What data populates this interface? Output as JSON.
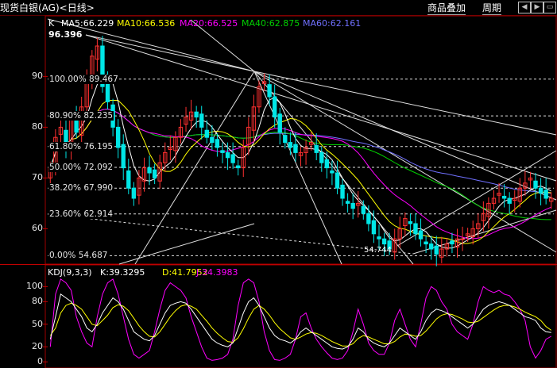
{
  "header": {
    "title": "现货白银(AG)<日线>",
    "btn_overlay": "商品叠加",
    "btn_period": "周期",
    "nav_icons": [
      "arrow-left-icon",
      "arrow-right-icon",
      "window-icon"
    ]
  },
  "main_panel": {
    "indicator": "K",
    "ma5_label": "MA5:66.229",
    "ma10_label": "MA10:66.536",
    "ma20_label": "MA20:66.525",
    "ma40_label": "MA40:62.875",
    "ma60_label": "MA60:62.161",
    "high_label": "96.396",
    "low_label": "54.744",
    "colors": {
      "ma5": "#ffffff",
      "ma10": "#ffff00",
      "ma20": "#ff00ff",
      "ma40": "#00d000",
      "ma60": "#7070ff",
      "up": "#ff3030",
      "down": "#00e6e6",
      "grid": "#7a0000",
      "axis": "#a00000"
    }
  },
  "fib_levels": [
    {
      "label": "100.00% 89.467",
      "value": 89.467
    },
    {
      "label": "80.90% 82.235",
      "value": 82.235
    },
    {
      "label": "61.80% 76.195",
      "value": 76.195
    },
    {
      "label": "50.00% 72.092",
      "value": 72.092
    },
    {
      "label": "38.20% 67.990",
      "value": 67.99
    },
    {
      "label": "23.60% 62.914",
      "value": 62.914
    },
    {
      "label": "0.00% 54.687",
      "value": 54.687
    }
  ],
  "kdj_panel": {
    "title": "KDJ(9,3,3)",
    "k_label": "K:39.3295",
    "d_label": "D:41.7952",
    "j_label": "J:34.3983",
    "colors": {
      "k": "#ffffff",
      "d": "#ffff00",
      "j": "#ff00ff"
    }
  },
  "chart_data": {
    "type": "candlestick",
    "price_yticks": [
      60,
      70,
      80,
      90
    ],
    "price_ylim": [
      53.5,
      98.5
    ],
    "kdj_yticks": [
      0,
      20,
      50,
      80,
      100
    ],
    "kdj_ylim": [
      -5,
      112
    ],
    "close": [
      72,
      78,
      80,
      76,
      82,
      79,
      84,
      89,
      94,
      96,
      88,
      85,
      80,
      76,
      72,
      68,
      66,
      70,
      72,
      71,
      70,
      73,
      75,
      76,
      78,
      80,
      82,
      83,
      82,
      80,
      78,
      77,
      76,
      75,
      74,
      73,
      72,
      76,
      80,
      84,
      88,
      89,
      86,
      82,
      79,
      77,
      76,
      75,
      75,
      76,
      77,
      75,
      73,
      72,
      71,
      68,
      66,
      65,
      64,
      65,
      63,
      61,
      59,
      58,
      57,
      56,
      58,
      60,
      62,
      61,
      59,
      58,
      57,
      56,
      55,
      56,
      57,
      57,
      58,
      58,
      59,
      60,
      61,
      63,
      65,
      66,
      67,
      66,
      65,
      66,
      68,
      69,
      70,
      68,
      67,
      66,
      66
    ],
    "k": [
      30,
      60,
      90,
      85,
      80,
      70,
      60,
      45,
      40,
      50,
      65,
      75,
      85,
      80,
      70,
      55,
      40,
      35,
      30,
      28,
      35,
      50,
      65,
      75,
      78,
      80,
      78,
      70,
      60,
      50,
      40,
      30,
      25,
      22,
      20,
      25,
      45,
      65,
      80,
      85,
      75,
      60,
      45,
      35,
      30,
      28,
      25,
      30,
      40,
      45,
      40,
      35,
      30,
      25,
      20,
      18,
      17,
      20,
      30,
      45,
      40,
      30,
      25,
      22,
      20,
      25,
      35,
      45,
      40,
      35,
      30,
      40,
      55,
      65,
      70,
      68,
      65,
      60,
      55,
      50,
      45,
      50,
      60,
      70,
      75,
      78,
      80,
      78,
      75,
      70,
      65,
      60,
      58,
      55,
      45,
      40,
      39
    ],
    "d": [
      35,
      45,
      65,
      75,
      78,
      75,
      70,
      60,
      50,
      48,
      55,
      62,
      72,
      76,
      74,
      68,
      58,
      48,
      40,
      34,
      33,
      40,
      50,
      60,
      68,
      74,
      76,
      74,
      70,
      62,
      54,
      45,
      38,
      32,
      27,
      26,
      32,
      44,
      58,
      70,
      75,
      70,
      62,
      52,
      44,
      38,
      32,
      30,
      33,
      37,
      39,
      38,
      35,
      31,
      27,
      24,
      21,
      21,
      24,
      31,
      35,
      33,
      30,
      27,
      24,
      24,
      27,
      33,
      37,
      36,
      34,
      35,
      41,
      49,
      57,
      62,
      64,
      63,
      60,
      57,
      53,
      52,
      54,
      59,
      64,
      69,
      73,
      75,
      75,
      73,
      70,
      66,
      63,
      60,
      55,
      47,
      42
    ],
    "j": [
      20,
      90,
      110,
      105,
      95,
      60,
      40,
      25,
      20,
      60,
      90,
      105,
      110,
      90,
      60,
      30,
      10,
      5,
      10,
      15,
      40,
      70,
      95,
      105,
      100,
      95,
      85,
      60,
      40,
      20,
      5,
      2,
      3,
      5,
      10,
      30,
      75,
      105,
      110,
      105,
      80,
      40,
      15,
      3,
      2,
      5,
      10,
      30,
      60,
      65,
      45,
      30,
      20,
      12,
      5,
      3,
      5,
      15,
      40,
      70,
      50,
      25,
      15,
      10,
      10,
      25,
      55,
      70,
      50,
      30,
      20,
      50,
      85,
      100,
      95,
      80,
      70,
      50,
      40,
      35,
      30,
      50,
      80,
      100,
      95,
      92,
      95,
      90,
      88,
      80,
      70,
      55,
      20,
      5,
      15,
      30,
      34
    ]
  }
}
